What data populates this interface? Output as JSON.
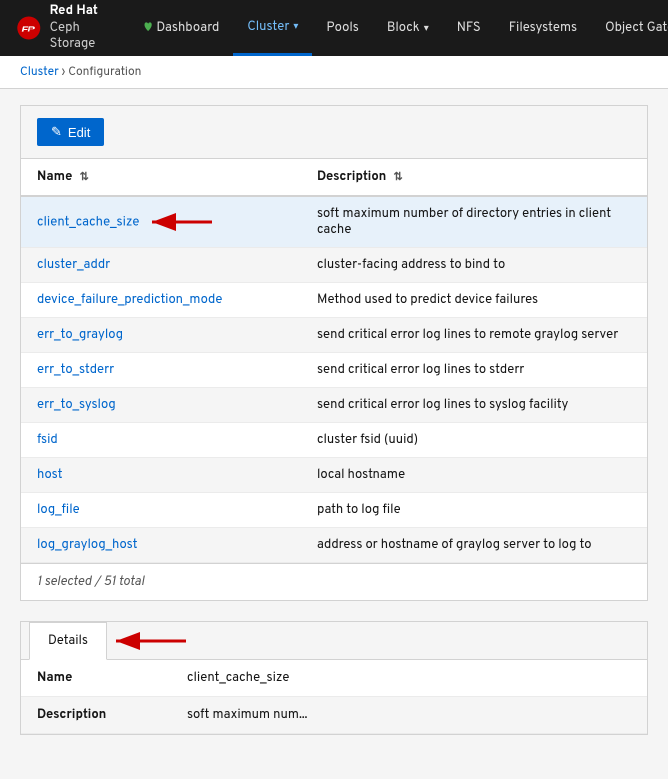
{
  "app": {
    "logo_line1": "Red Hat",
    "logo_line2": "Ceph Storage"
  },
  "nav": {
    "items": [
      {
        "label": "Dashboard",
        "active": false,
        "hasDropdown": false
      },
      {
        "label": "Cluster",
        "active": true,
        "hasDropdown": true
      },
      {
        "label": "Pools",
        "active": false,
        "hasDropdown": false
      },
      {
        "label": "Block",
        "active": false,
        "hasDropdown": true
      },
      {
        "label": "NFS",
        "active": false,
        "hasDropdown": false
      },
      {
        "label": "Filesystems",
        "active": false,
        "hasDropdown": false
      },
      {
        "label": "Object Gateway",
        "active": false,
        "hasDropdown": true
      }
    ]
  },
  "breadcrumb": {
    "parent": "Cluster",
    "current": "Configuration"
  },
  "toolbar": {
    "edit_label": "Edit"
  },
  "table": {
    "columns": [
      {
        "label": "Name",
        "sortable": true
      },
      {
        "label": "Description",
        "sortable": true
      }
    ],
    "rows": [
      {
        "name": "client_cache_size",
        "description": "soft maximum number of directory entries in client cache",
        "selected": true
      },
      {
        "name": "cluster_addr",
        "description": "cluster-facing address to bind to",
        "selected": false
      },
      {
        "name": "device_failure_prediction_mode",
        "description": "Method used to predict device failures",
        "selected": false
      },
      {
        "name": "err_to_graylog",
        "description": "send critical error log lines to remote graylog server",
        "selected": false
      },
      {
        "name": "err_to_stderr",
        "description": "send critical error log lines to stderr",
        "selected": false
      },
      {
        "name": "err_to_syslog",
        "description": "send critical error log lines to syslog facility",
        "selected": false
      },
      {
        "name": "fsid",
        "description": "cluster fsid (uuid)",
        "selected": false
      },
      {
        "name": "host",
        "description": "local hostname",
        "selected": false
      },
      {
        "name": "log_file",
        "description": "path to log file",
        "selected": false
      },
      {
        "name": "log_graylog_host",
        "description": "address or hostname of graylog server to log to",
        "selected": false
      }
    ],
    "footer": "1 selected / 51 total"
  },
  "details": {
    "tab_label": "Details",
    "rows": [
      {
        "label": "Name",
        "value": "client_cache_size"
      },
      {
        "label": "Description",
        "value": "soft maximum num..."
      }
    ]
  }
}
